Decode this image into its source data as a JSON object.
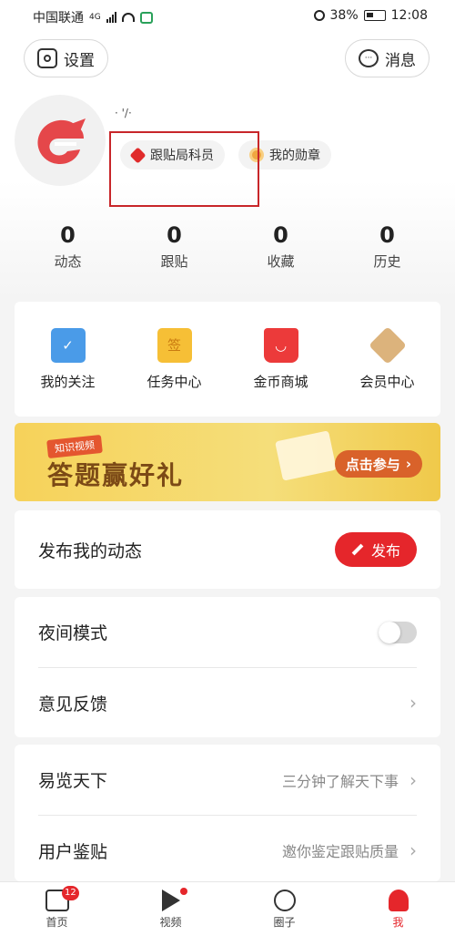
{
  "status_bar": {
    "carrier": "中国联通",
    "network": "4G",
    "battery": "38%",
    "time": "12:08"
  },
  "header": {
    "settings_label": "设置",
    "messages_label": "消息"
  },
  "profile": {
    "username": "·  '/·",
    "badges": [
      {
        "label": "跟贴局科员",
        "icon": "cube-icon"
      },
      {
        "label": "我的勋章",
        "icon": "medal-icon"
      }
    ],
    "stats": [
      {
        "value": "0",
        "label": "动态"
      },
      {
        "value": "0",
        "label": "跟贴"
      },
      {
        "value": "0",
        "label": "收藏"
      },
      {
        "value": "0",
        "label": "历史"
      }
    ]
  },
  "features": [
    {
      "label": "我的关注",
      "icon": "bookmark-icon"
    },
    {
      "label": "任务中心",
      "icon": "sign-icon",
      "glyph": "签"
    },
    {
      "label": "金币商城",
      "icon": "shopping-bag-icon"
    },
    {
      "label": "会员中心",
      "icon": "diamond-icon"
    }
  ],
  "banner": {
    "tag": "知识视频",
    "title": "答题赢好礼",
    "cta": "点击参与"
  },
  "publish": {
    "title": "发布我的动态",
    "button": "发布"
  },
  "settings": {
    "night_mode": {
      "label": "夜间模式",
      "enabled": false
    },
    "feedback": {
      "label": "意见反馈"
    }
  },
  "more": [
    {
      "label": "易览天下",
      "subtitle": "三分钟了解天下事"
    },
    {
      "label": "用户鉴贴",
      "subtitle": "邀你鉴定跟贴质量"
    }
  ],
  "bottom_nav": [
    {
      "label": "首页",
      "badge": "12"
    },
    {
      "label": "视频"
    },
    {
      "label": "圈子"
    },
    {
      "label": "我",
      "active": true
    }
  ],
  "colors": {
    "accent": "#e5262b",
    "highlight_box": "#c8262a"
  }
}
